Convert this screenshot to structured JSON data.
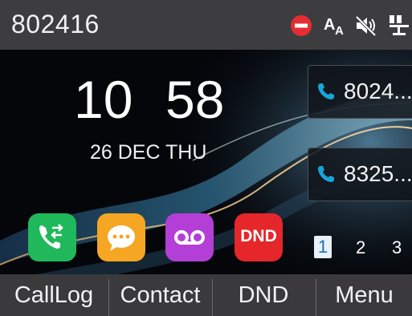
{
  "status": {
    "extension": "802416",
    "icons": [
      "dnd-status-icon",
      "font-size-icon",
      "mute-icon",
      "network-icon"
    ]
  },
  "clock": {
    "hour": "10",
    "minute": "58",
    "date": "26 DEC THU"
  },
  "accounts": [
    {
      "number": "8024...",
      "icon": "phone-icon"
    },
    {
      "number": "8325...",
      "icon": "phone-icon"
    }
  ],
  "apps": [
    {
      "name": "call-log-app",
      "icon": "phone-transfer-icon",
      "color": "#1fb85a"
    },
    {
      "name": "messages-app",
      "icon": "chat-bubble-icon",
      "color": "#f5a623"
    },
    {
      "name": "voicemail-app",
      "icon": "voicemail-icon",
      "color": "#b43fd6"
    },
    {
      "name": "dnd-app",
      "label": "DND",
      "color": "#e5262b"
    }
  ],
  "pages": [
    "1",
    "2",
    "3"
  ],
  "active_page": "1",
  "softkeys": [
    "CallLog",
    "Contact",
    "DND",
    "Menu"
  ],
  "colors": {
    "statusbar": "#3d3d40",
    "accent": "#1aa3d8",
    "dnd_red": "#e5262b"
  }
}
